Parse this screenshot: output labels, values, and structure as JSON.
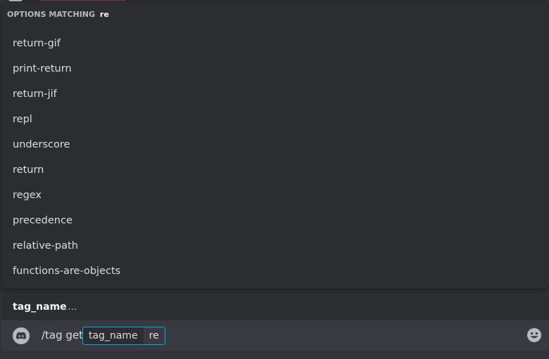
{
  "autocomplete": {
    "header_label": "OPTIONS MATCHING",
    "query": "re",
    "options": [
      {
        "label": "return-gif"
      },
      {
        "label": "print-return"
      },
      {
        "label": "return-jif"
      },
      {
        "label": "repl"
      },
      {
        "label": "underscore"
      },
      {
        "label": "return"
      },
      {
        "label": "regex"
      },
      {
        "label": "precedence"
      },
      {
        "label": "relative-path"
      },
      {
        "label": "functions-are-objects"
      }
    ]
  },
  "option_hint": {
    "name": "tag_name",
    "description": "..."
  },
  "input": {
    "app_icon": "discord-icon",
    "command": "/tag get",
    "option_name": "tag_name",
    "option_value": "re",
    "emoji_icon": "smiley-face-icon"
  },
  "colors": {
    "background": "#313338",
    "popup": "#2b2d31",
    "input_bar": "#383a40",
    "pill_border": "#00a8fc",
    "text_primary": "#dbdee1",
    "text_muted": "#b5bac1"
  }
}
